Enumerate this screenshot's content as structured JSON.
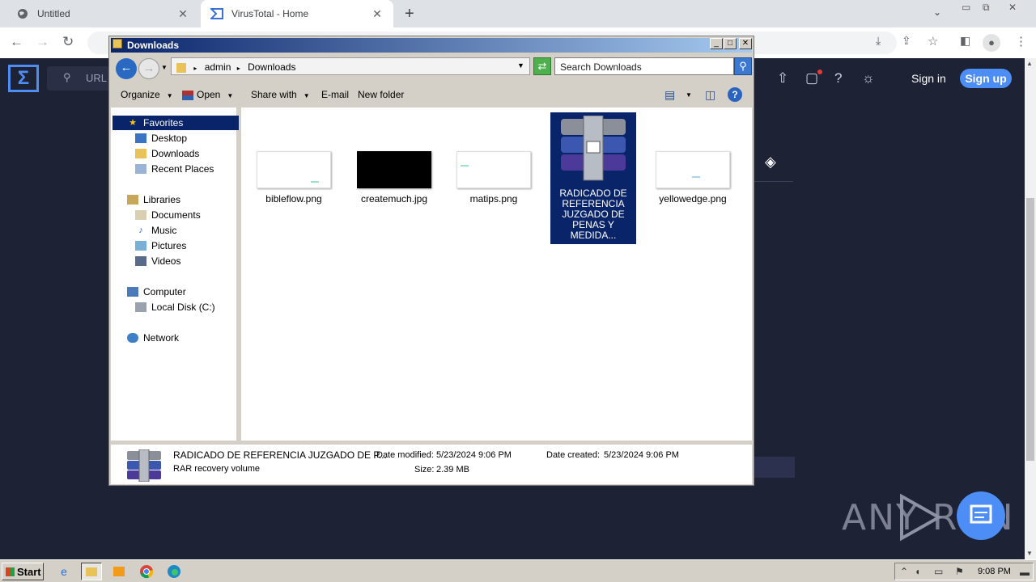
{
  "browser": {
    "tabs": [
      {
        "title": "Untitled",
        "close": "✕"
      },
      {
        "title": "VirusTotal - Home",
        "close": "✕"
      }
    ],
    "new_tab": "+",
    "tab_menu": "⌄",
    "window_controls": {
      "minimize": "▭",
      "restore": "⧉",
      "close": "✕"
    }
  },
  "virustotal": {
    "logo": "Σ",
    "search_placeholder": "URL",
    "sign_in": "Sign in",
    "sign_up": "Sign up",
    "brand_color": "#4c8df6"
  },
  "explorer": {
    "title": "Downloads",
    "breadcrumb": [
      "admin",
      "Downloads"
    ],
    "search_placeholder": "Search Downloads",
    "commands": {
      "organize": "Organize",
      "open": "Open",
      "share_with": "Share with",
      "email": "E-mail",
      "new_folder": "New folder"
    },
    "nav": {
      "favorites": "Favorites",
      "desktop": "Desktop",
      "downloads": "Downloads",
      "recent_places": "Recent Places",
      "libraries": "Libraries",
      "documents": "Documents",
      "music": "Music",
      "pictures": "Pictures",
      "videos": "Videos",
      "computer": "Computer",
      "local_disk": "Local Disk (C:)",
      "network": "Network"
    },
    "files": [
      {
        "name": "bibleflow.png"
      },
      {
        "name": "createmuch.jpg"
      },
      {
        "name": "matips.png"
      },
      {
        "name": "yellowedge.png"
      },
      {
        "name": "RADICADO DE REFERENCIA JUZGADO DE PENAS Y MEDIDA...",
        "selected": true
      }
    ],
    "details": {
      "filename": "RADICADO DE REFERENCIA JUZGADO DE P...",
      "type": "RAR recovery volume",
      "date_modified_label": "Date modified:",
      "date_modified": "5/23/2024 9:06 PM",
      "size_label": "Size:",
      "size": "2.39 MB",
      "date_created_label": "Date created:",
      "date_created": "5/23/2024 9:06 PM"
    }
  },
  "watermark": {
    "text": "ANY RUN"
  },
  "taskbar": {
    "start": "Start",
    "clock": "9:08 PM"
  }
}
